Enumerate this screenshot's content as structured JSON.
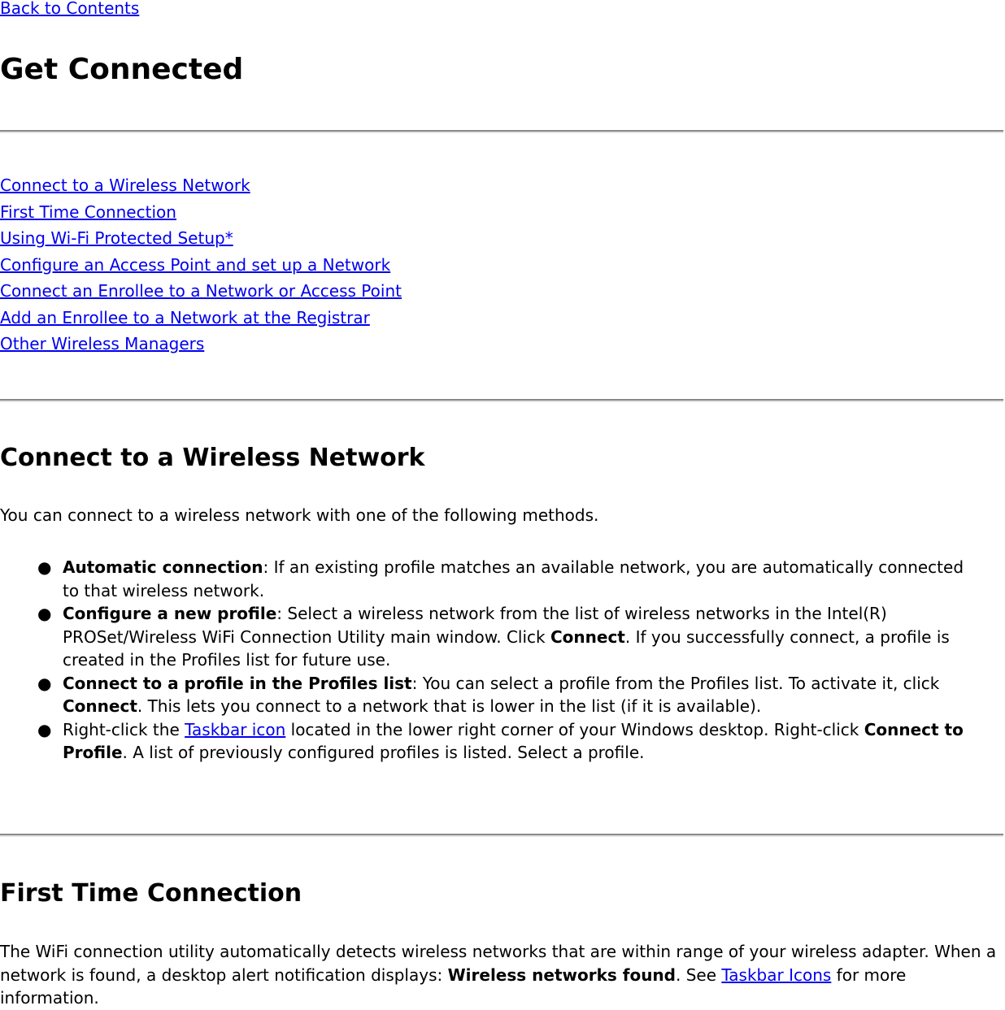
{
  "nav": {
    "back_link": "Back to Contents"
  },
  "page": {
    "title": "Get Connected"
  },
  "toc": {
    "links": [
      "Connect to a Wireless Network",
      "First Time Connection",
      "Using Wi-Fi Protected Setup*",
      "Configure an Access Point and set up a Network ",
      "Connect an Enrollee to a Network or Access Point ",
      "Add an Enrollee to a Network at the Registrar",
      "Other Wireless Managers"
    ]
  },
  "section_connect": {
    "title": "Connect to a Wireless Network",
    "intro": "You can connect to a wireless network with one of the following methods.",
    "bullet_glyph": "●",
    "items": [
      {
        "term": "Automatic connection",
        "text": ": If an existing profile matches an available network, you are automatically connected to that wireless network."
      },
      {
        "term": "Configure a new profile",
        "text_before": ": Select a wireless network from the list of wireless networks in the Intel(R) PROSet/Wireless WiFi Connection Utility main window. Click ",
        "bold": "Connect",
        "text_after": ". If you successfully connect, a profile is created in the Profiles list for future use."
      },
      {
        "term": "Connect to a profile in the Profiles list",
        "text_before": ": You can select a profile from the Profiles list. To activate it, click ",
        "bold": "Connect",
        "text_after": ". This lets you connect to a network that is lower in the list (if it is available)."
      },
      {
        "text_before": "Right-click the ",
        "link": "Taskbar icon",
        "text_middle": " located in the lower right corner of your Windows desktop. Right-click ",
        "bold": "Connect to Profile",
        "text_after": ". A list of previously configured profiles is listed. Select a profile."
      }
    ]
  },
  "section_first_time": {
    "title": "First Time Connection",
    "text_before": "The WiFi connection utility automatically detects wireless networks that are within range of your wireless adapter. When a network is found, a desktop alert notification displays: ",
    "bold": "Wireless networks found",
    "text_middle": ". See ",
    "link": "Taskbar Icons",
    "text_after": " for more information."
  },
  "colors": {
    "link": "#0000ee",
    "text": "#000000",
    "rule_dark": "#888888",
    "rule_light": "#e4e4e4"
  }
}
